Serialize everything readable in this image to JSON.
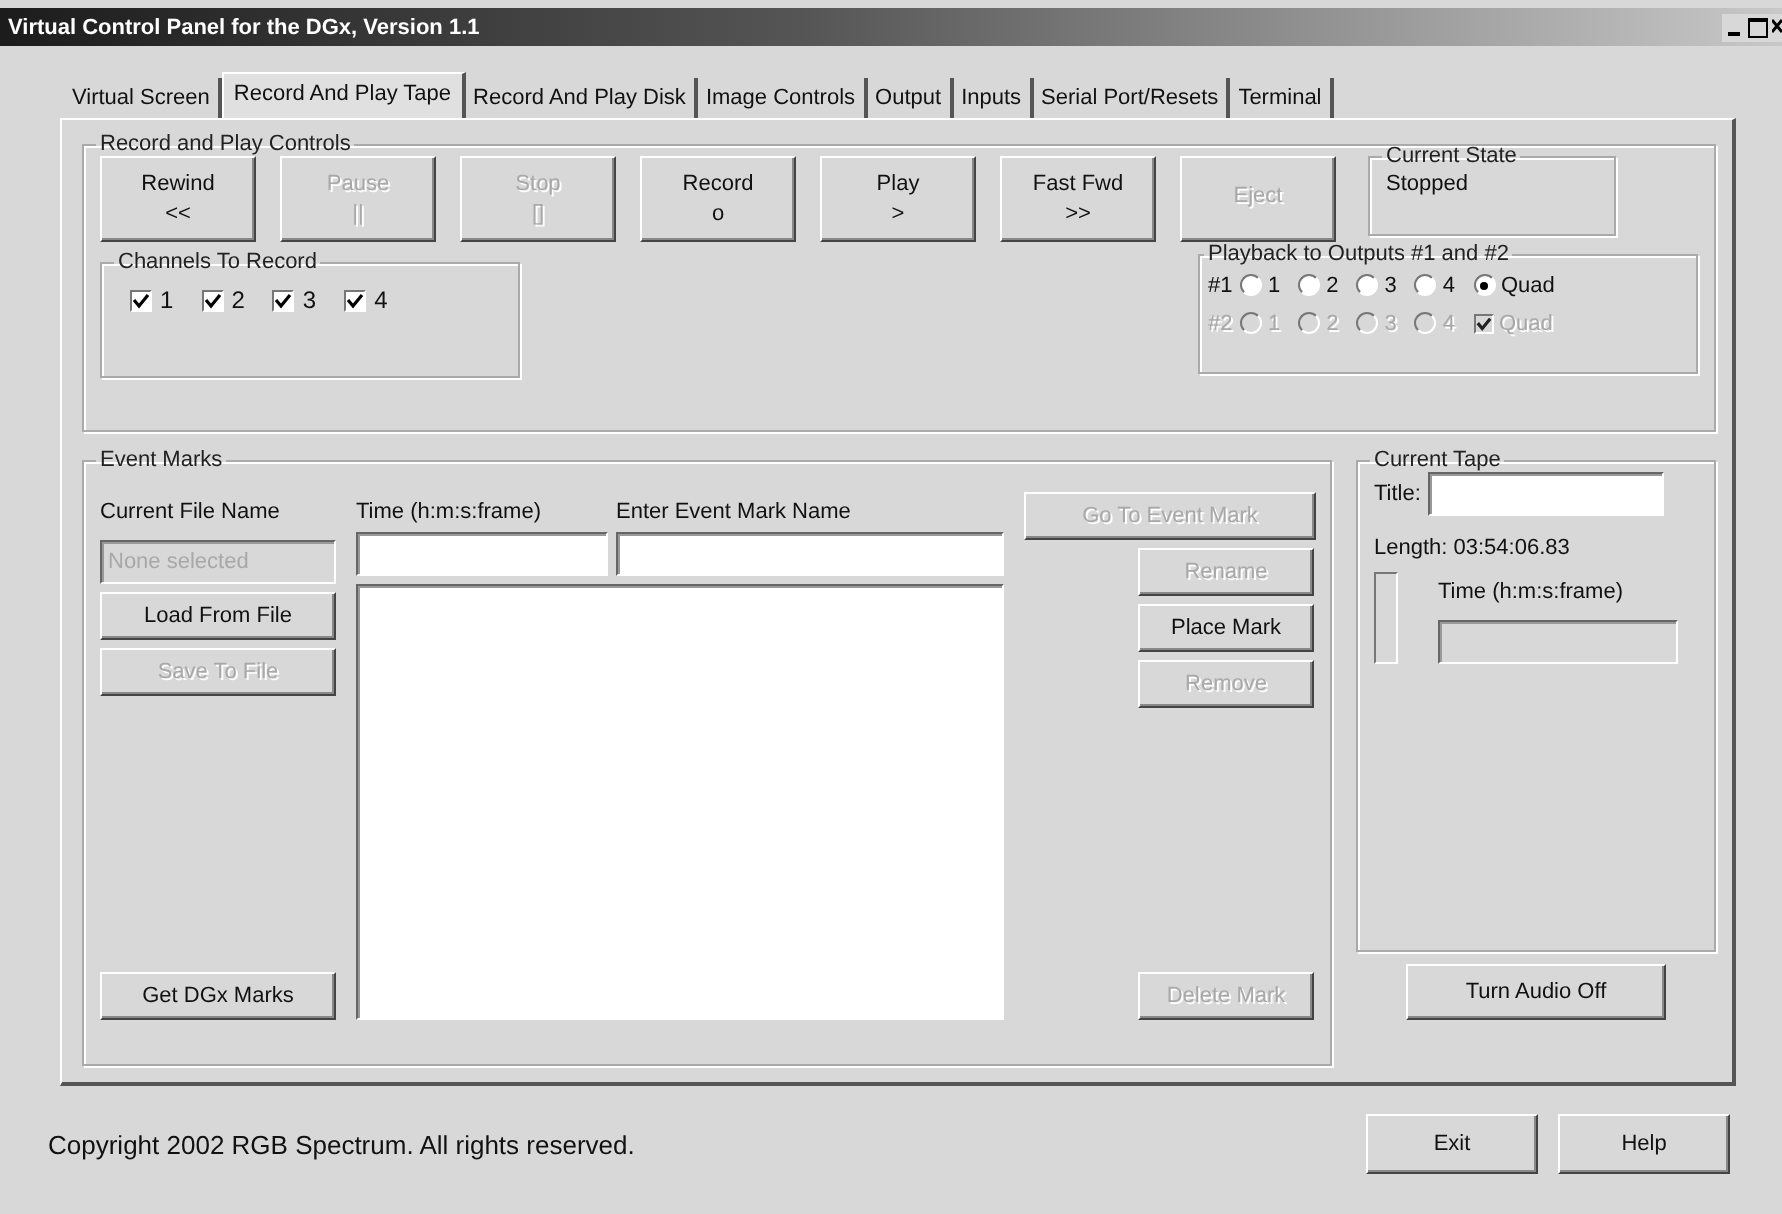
{
  "window": {
    "title": "Virtual Control Panel for the DGx, Version 1.1"
  },
  "tabs": [
    {
      "label": "Virtual Screen",
      "selected": false
    },
    {
      "label": "Record And Play Tape",
      "selected": true
    },
    {
      "label": "Record And Play Disk",
      "selected": false
    },
    {
      "label": "Image Controls",
      "selected": false
    },
    {
      "label": "Output",
      "selected": false
    },
    {
      "label": "Inputs",
      "selected": false
    },
    {
      "label": "Serial Port/Resets",
      "selected": false
    },
    {
      "label": "Terminal",
      "selected": false
    }
  ],
  "record_controls": {
    "title": "Record and Play Controls",
    "buttons": [
      {
        "label": "Rewind",
        "symbol": "<<",
        "disabled": false
      },
      {
        "label": "Pause",
        "symbol": "||",
        "disabled": true
      },
      {
        "label": "Stop",
        "symbol": "[]",
        "disabled": true
      },
      {
        "label": "Record",
        "symbol": "o",
        "disabled": false
      },
      {
        "label": "Play",
        "symbol": ">",
        "disabled": false
      },
      {
        "label": "Fast Fwd",
        "symbol": ">>",
        "disabled": false
      },
      {
        "label": "Eject",
        "disabled": true
      }
    ],
    "current_state": {
      "title": "Current State",
      "value": "Stopped"
    },
    "channels": {
      "title": "Channels To Record",
      "items": [
        {
          "label": "1",
          "checked": true
        },
        {
          "label": "2",
          "checked": true
        },
        {
          "label": "3",
          "checked": true
        },
        {
          "label": "4",
          "checked": true
        }
      ]
    },
    "playback": {
      "title": "Playback to Outputs #1 and #2",
      "rows": [
        {
          "label": "#1",
          "disabled": false,
          "options": [
            {
              "kind": "radio",
              "label": "1",
              "selected": false
            },
            {
              "kind": "radio",
              "label": "2",
              "selected": false
            },
            {
              "kind": "radio",
              "label": "3",
              "selected": false
            },
            {
              "kind": "radio",
              "label": "4",
              "selected": false
            },
            {
              "kind": "radio",
              "label": "Quad",
              "selected": true
            }
          ]
        },
        {
          "label": "#2",
          "disabled": true,
          "options": [
            {
              "kind": "radio",
              "label": "1",
              "selected": false
            },
            {
              "kind": "radio",
              "label": "2",
              "selected": false
            },
            {
              "kind": "radio",
              "label": "3",
              "selected": false
            },
            {
              "kind": "radio",
              "label": "4",
              "selected": false
            },
            {
              "kind": "checkbox",
              "label": "Quad",
              "selected": true
            }
          ]
        }
      ]
    }
  },
  "event_marks": {
    "title": "Event Marks",
    "file_label": "Current File Name",
    "file_placeholder": "None selected",
    "time_label": "Time (h:m:s:frame)",
    "name_label": "Enter Event Mark Name",
    "left_buttons": [
      {
        "label": "Load From File",
        "disabled": false
      },
      {
        "label": "Save To File",
        "disabled": true
      }
    ],
    "bottom_left_button": {
      "label": "Get DGx Marks",
      "disabled": false
    },
    "goto_button": {
      "label": "Go To Event Mark",
      "disabled": true
    },
    "right_buttons": [
      {
        "label": "Rename",
        "disabled": true
      },
      {
        "label": "Place Mark",
        "disabled": false
      },
      {
        "label": "Remove",
        "disabled": true
      }
    ],
    "bottom_right_button": {
      "label": "Delete Mark",
      "disabled": true
    }
  },
  "current_tape": {
    "title": "Current Tape",
    "title_label": "Title:",
    "length": "Length: 03:54:06.83",
    "time_label": "Time (h:m:s:frame)"
  },
  "audio_button": {
    "label": "Turn Audio Off",
    "disabled": false
  },
  "status_bar": {
    "text": "Copyright 2002 RGB Spectrum.  All rights reserved."
  },
  "footer_buttons": [
    {
      "label": "Exit",
      "disabled": false
    },
    {
      "label": "Help",
      "disabled": false
    }
  ]
}
